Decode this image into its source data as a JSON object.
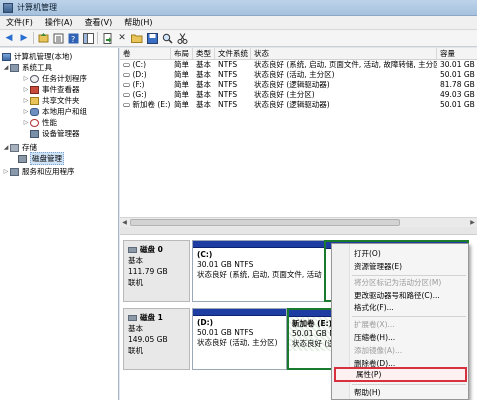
{
  "window": {
    "title": "计算机管理"
  },
  "menu": [
    "文件(F)",
    "操作(A)",
    "查看(V)",
    "帮助(H)"
  ],
  "toolbar": {
    "icons": [
      "back-icon",
      "forward-icon",
      "up-icon",
      "properties-icon",
      "help-icon",
      "show-hide-icon",
      "export-icon",
      "delete-icon",
      "open-folder-icon",
      "save-icon",
      "search-icon",
      "cut-icon"
    ]
  },
  "tree": {
    "root": "计算机管理(本地)",
    "system_tools": "系统工具",
    "task_scheduler": "任务计划程序",
    "event_viewer": "事件查看器",
    "shared_folders": "共享文件夹",
    "local_users": "本地用户和组",
    "performance": "性能",
    "device_manager": "设备管理器",
    "storage": "存储",
    "disk_management": "磁盘管理",
    "services_apps": "服务和应用程序"
  },
  "volumes": {
    "headers": {
      "volume": "卷",
      "layout": "布局",
      "type": "类型",
      "fs": "文件系统",
      "status": "状态",
      "capacity": "容量"
    },
    "rows": [
      {
        "volume": "(C:)",
        "layout": "简单",
        "type": "基本",
        "fs": "NTFS",
        "status": "状态良好 (系统, 启动, 页面文件, 活动, 故障转储, 主分区)",
        "capacity": "30.01 GB"
      },
      {
        "volume": "(D:)",
        "layout": "简单",
        "type": "基本",
        "fs": "NTFS",
        "status": "状态良好 (活动, 主分区)",
        "capacity": "50.01 GB"
      },
      {
        "volume": "(F:)",
        "layout": "简单",
        "type": "基本",
        "fs": "NTFS",
        "status": "状态良好 (逻辑驱动器)",
        "capacity": "81.78 GB"
      },
      {
        "volume": "(G:)",
        "layout": "简单",
        "type": "基本",
        "fs": "NTFS",
        "status": "状态良好 (主分区)",
        "capacity": "49.03 GB"
      },
      {
        "volume": "新加卷 (E:)",
        "layout": "简单",
        "type": "基本",
        "fs": "NTFS",
        "status": "状态良好 (逻辑驱动器)",
        "capacity": "50.01 GB"
      }
    ]
  },
  "disks": [
    {
      "name": "磁盘 0",
      "type": "基本",
      "size": "111.79 GB",
      "state": "联机",
      "partition": {
        "name": "(C:)",
        "size": "30.01 GB NTFS",
        "status": "状态良好 (系统, 启动, 页面文件, 活动"
      }
    },
    {
      "name": "磁盘 1",
      "type": "基本",
      "size": "149.05 GB",
      "state": "联机",
      "partition_d": {
        "name": "(D:)",
        "size": "50.01 GB NTFS",
        "status": "状态良好 (活动, 主分区)"
      },
      "partition_e": {
        "name": "新加卷 (E:)",
        "size": "50.01 GB NTFS",
        "status": "状态良好 (逻"
      }
    }
  ],
  "context_menu": {
    "open": "打开(O)",
    "explorer": "资源管理器(E)",
    "mark_active": "将分区标记为活动分区(M)",
    "change_letter": "更改驱动器号和路径(C)...",
    "format": "格式化(F)...",
    "extend": "扩展卷(X)...",
    "shrink": "压缩卷(H)...",
    "mirror": "添加镜像(A)...",
    "delete": "删除卷(D)...",
    "properties": "属性(P)",
    "help": "帮助(H)"
  }
}
